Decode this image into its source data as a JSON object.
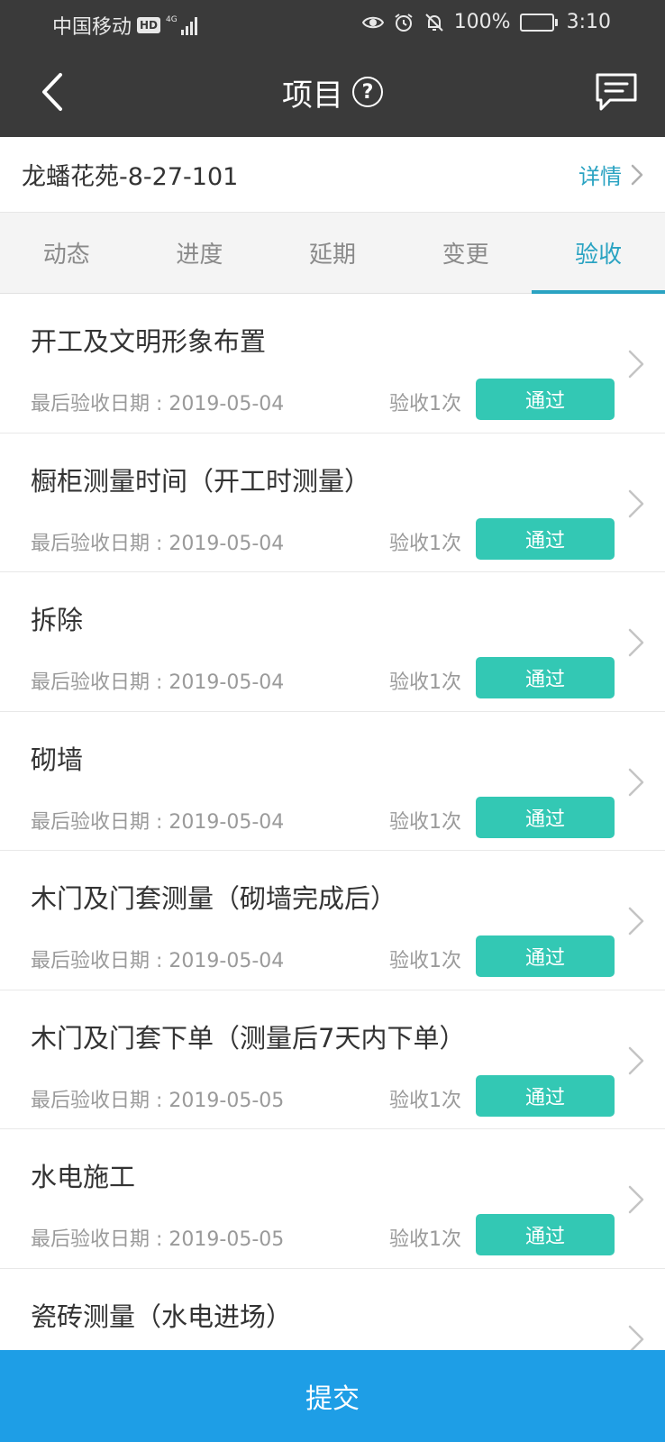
{
  "status_bar": {
    "carrier": "中国移动",
    "hd_badge": "HD",
    "network": "4G",
    "battery_text": "100%",
    "time": "3:10"
  },
  "nav": {
    "title": "项目",
    "help_label": "?"
  },
  "project": {
    "name": "龙蟠花苑-8-27-101",
    "detail_label": "详情"
  },
  "tabs": [
    {
      "label": "动态",
      "active": false
    },
    {
      "label": "进度",
      "active": false
    },
    {
      "label": "延期",
      "active": false
    },
    {
      "label": "变更",
      "active": false
    },
    {
      "label": "验收",
      "active": true
    }
  ],
  "items": [
    {
      "title": "开工及文明形象布置",
      "date": "最后验收日期 : 2019-05-04",
      "count": "验收1次",
      "status": "通过"
    },
    {
      "title": "橱柜测量时间（开工时测量）",
      "date": "最后验收日期 : 2019-05-04",
      "count": "验收1次",
      "status": "通过"
    },
    {
      "title": "拆除",
      "date": "最后验收日期 : 2019-05-04",
      "count": "验收1次",
      "status": "通过"
    },
    {
      "title": "砌墙",
      "date": "最后验收日期 : 2019-05-04",
      "count": "验收1次",
      "status": "通过"
    },
    {
      "title": "木门及门套测量（砌墙完成后）",
      "date": "最后验收日期 : 2019-05-04",
      "count": "验收1次",
      "status": "通过"
    },
    {
      "title": "木门及门套下单（测量后7天内下单）",
      "date": "最后验收日期 : 2019-05-05",
      "count": "验收1次",
      "status": "通过"
    },
    {
      "title": "水电施工",
      "date": "最后验收日期 : 2019-05-05",
      "count": "验收1次",
      "status": "通过"
    },
    {
      "title": "瓷砖测量（水电进场）",
      "date": "",
      "count": "",
      "status": ""
    }
  ],
  "submit_label": "提交",
  "colors": {
    "header_bg": "#3a3a3a",
    "accent": "#2aa3c2",
    "pass_badge": "#33c8b4",
    "submit_bg": "#1e9ee6"
  }
}
